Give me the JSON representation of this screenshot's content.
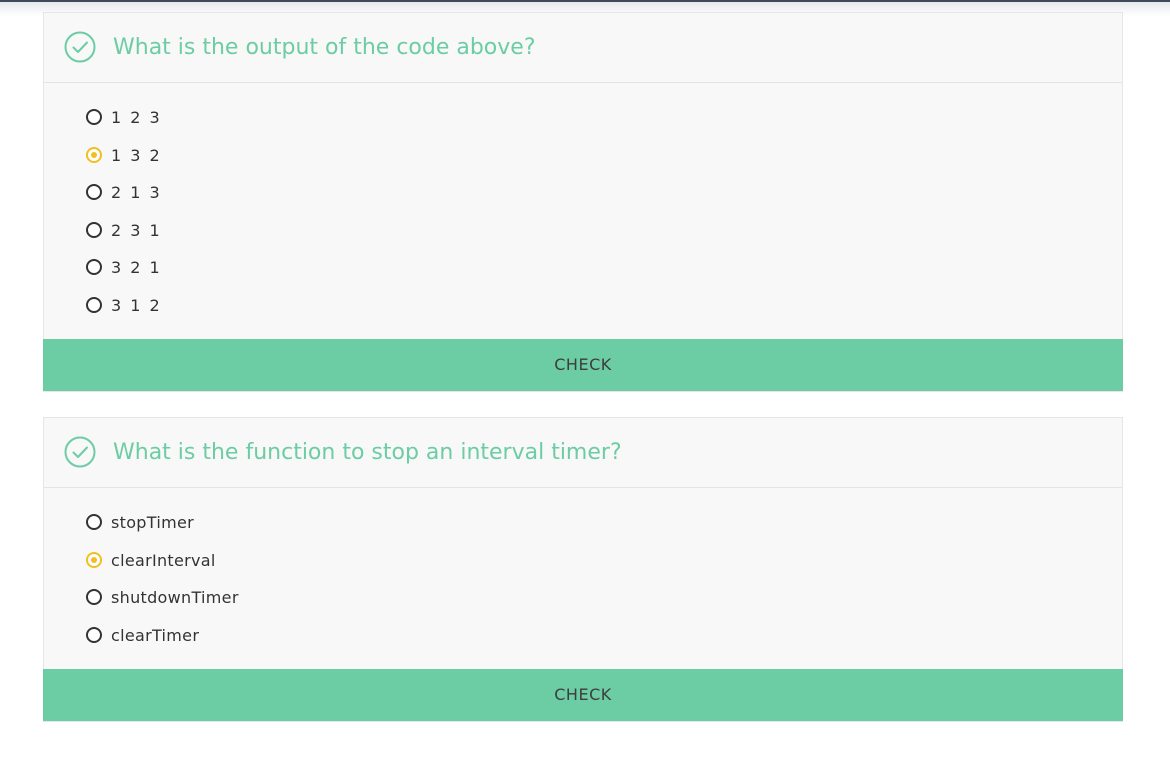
{
  "colors": {
    "accent": "#6ccda4",
    "selected": "#f2be22",
    "panel": "#f8f8f8"
  },
  "quizzes": [
    {
      "question": "What is the output of the code above?",
      "status_icon": "check-circle-icon",
      "options": [
        {
          "label": "1 2 3",
          "selected": false
        },
        {
          "label": "1 3 2",
          "selected": true
        },
        {
          "label": "2 1 3",
          "selected": false
        },
        {
          "label": "2 3 1",
          "selected": false
        },
        {
          "label": "3 2 1",
          "selected": false
        },
        {
          "label": "3 1 2",
          "selected": false
        }
      ],
      "button_label": "CHECK"
    },
    {
      "question": "What is the function to stop an interval timer?",
      "status_icon": "check-circle-icon",
      "options": [
        {
          "label": "stopTimer",
          "selected": false
        },
        {
          "label": "clearInterval",
          "selected": true
        },
        {
          "label": "shutdownTimer",
          "selected": false
        },
        {
          "label": "clearTimer",
          "selected": false
        }
      ],
      "button_label": "CHECK"
    }
  ]
}
